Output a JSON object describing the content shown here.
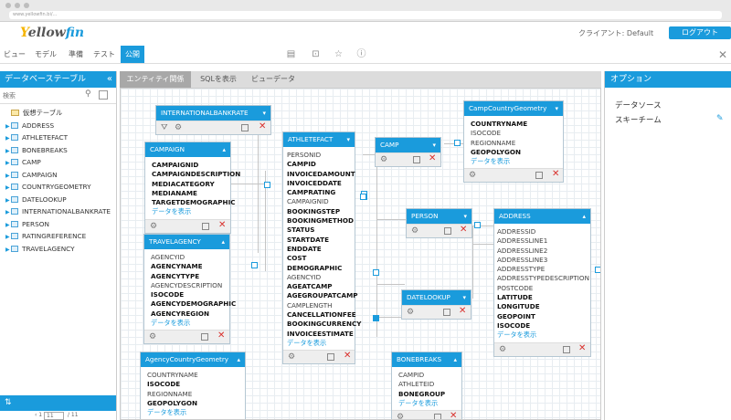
{
  "browser": {
    "url": "www.yellowfin.bi/..."
  },
  "header": {
    "logo": {
      "y": "Y",
      "ellow": "ellow",
      "fin": "fin"
    },
    "client_label": "クライアント: Default",
    "logout_label": "ログアウト"
  },
  "menubar": {
    "items": [
      "ビュー",
      "モデル",
      "準備",
      "テスト",
      "公開"
    ],
    "active_index": 4,
    "tool_icons": [
      "table-icon",
      "lock-icon",
      "star-icon",
      "info-icon"
    ]
  },
  "left_panel": {
    "title": "データベーステーブル",
    "collapse_glyph": "«",
    "search_placeholder": "検索",
    "items": [
      {
        "label": "仮想テーブル",
        "type": "folder"
      },
      {
        "label": "ADDRESS",
        "type": "table"
      },
      {
        "label": "ATHLETEFACT",
        "type": "table"
      },
      {
        "label": "BONEBREAKS",
        "type": "table"
      },
      {
        "label": "CAMP",
        "type": "table"
      },
      {
        "label": "CAMPAIGN",
        "type": "table"
      },
      {
        "label": "COUNTRYGEOMETRY",
        "type": "table"
      },
      {
        "label": "DATELOOKUP",
        "type": "table"
      },
      {
        "label": "INTERNATIONALBANKRATE",
        "type": "table"
      },
      {
        "label": "PERSON",
        "type": "table"
      },
      {
        "label": "RATINGREFERENCE",
        "type": "table"
      },
      {
        "label": "TRAVELAGENCY",
        "type": "table"
      }
    ],
    "pager": {
      "prev": "‹ 1",
      "current": "11",
      "total": "/ 11"
    }
  },
  "tabs": [
    "エンティティ関係",
    "SQLを表示",
    "ビューデータ"
  ],
  "active_tab": 0,
  "entities": {
    "internationalbankrate": {
      "name": "INTERNATIONALBANKRATE",
      "fields": []
    },
    "campaign": {
      "name": "CAMPAIGN",
      "fields": [
        {
          "label": "CAMPAIGNID",
          "bold": true
        },
        {
          "label": "CAMPAIGNDESCRIPTION",
          "bold": true
        },
        {
          "label": "MEDIACATEGORY",
          "bold": true
        },
        {
          "label": "MEDIANAME",
          "bold": true
        },
        {
          "label": "TARGETDEMOGRAPHIC",
          "bold": true
        }
      ],
      "more": "データを表示"
    },
    "travelagency": {
      "name": "TRAVELAGENCY",
      "fields": [
        {
          "label": "AGENCYID",
          "bold": false
        },
        {
          "label": "AGENCYNAME",
          "bold": true
        },
        {
          "label": "AGENCYTYPE",
          "bold": true
        },
        {
          "label": "AGENCYDESCRIPTION",
          "bold": false
        },
        {
          "label": "ISOCODE",
          "bold": true
        },
        {
          "label": "AGENCYDEMOGRAPHIC",
          "bold": true
        },
        {
          "label": "AGENCYREGION",
          "bold": true
        }
      ],
      "more": "データを表示"
    },
    "agencycountrygeometry": {
      "name": "AgencyCountryGeometry",
      "fields": [
        {
          "label": "COUNTRYNAME",
          "bold": false
        },
        {
          "label": "ISOCODE",
          "bold": true
        },
        {
          "label": "REGIONNAME",
          "bold": false
        },
        {
          "label": "GEOPOLYGON",
          "bold": true
        }
      ],
      "more": "データを表示"
    },
    "athletefact": {
      "name": "ATHLETEFACT",
      "fields": [
        {
          "label": "PERSONID",
          "bold": false
        },
        {
          "label": "CAMPID",
          "bold": true
        },
        {
          "label": "INVOICEDAMOUNT",
          "bold": true
        },
        {
          "label": "INVOICEDDATE",
          "bold": true
        },
        {
          "label": "CAMPRATING",
          "bold": true
        },
        {
          "label": "CAMPAIGNID",
          "bold": false
        },
        {
          "label": "BOOKINGSTEP",
          "bold": true
        },
        {
          "label": "BOOKINGMETHOD",
          "bold": true
        },
        {
          "label": "STATUS",
          "bold": true
        },
        {
          "label": "STARTDATE",
          "bold": true
        },
        {
          "label": "ENDDATE",
          "bold": true
        },
        {
          "label": "COST",
          "bold": true
        },
        {
          "label": "DEMOGRAPHIC",
          "bold": true
        },
        {
          "label": "AGENCYID",
          "bold": false
        },
        {
          "label": "AGEATCAMP",
          "bold": true
        },
        {
          "label": "AGEGROUPATCAMP",
          "bold": true
        },
        {
          "label": "CAMPLENGTH",
          "bold": false
        },
        {
          "label": "CANCELLATIONFEE",
          "bold": true
        },
        {
          "label": "BOOKINGCURRENCY",
          "bold": true
        },
        {
          "label": "INVOICEESTIMATE",
          "bold": true
        }
      ],
      "more": "データを表示"
    },
    "camp": {
      "name": "CAMP",
      "fields": []
    },
    "campcountrygeometry": {
      "name": "CampCountryGeometry",
      "fields": [
        {
          "label": "COUNTRYNAME",
          "bold": true
        },
        {
          "label": "ISOCODE",
          "bold": false
        },
        {
          "label": "REGIONNAME",
          "bold": false
        },
        {
          "label": "GEOPOLYGON",
          "bold": true
        }
      ],
      "more": "データを表示"
    },
    "person": {
      "name": "PERSON",
      "fields": []
    },
    "address": {
      "name": "ADDRESS",
      "fields": [
        {
          "label": "ADDRESSID",
          "bold": false
        },
        {
          "label": "ADDRESSLINE1",
          "bold": false
        },
        {
          "label": "ADDRESSLINE2",
          "bold": false
        },
        {
          "label": "ADDRESSLINE3",
          "bold": false
        },
        {
          "label": "ADDRESSTYPE",
          "bold": false
        },
        {
          "label": "ADDRESSTYPEDESCRIPTION",
          "bold": false
        },
        {
          "label": "POSTCODE",
          "bold": false
        },
        {
          "label": "LATITUDE",
          "bold": true
        },
        {
          "label": "LONGITUDE",
          "bold": true
        },
        {
          "label": "GEOPOINT",
          "bold": true
        },
        {
          "label": "ISOCODE",
          "bold": true
        }
      ],
      "more": "データを表示"
    },
    "datelookup": {
      "name": "DATELOOKUP",
      "fields": []
    },
    "bonebreaks": {
      "name": "BONEBREAKS",
      "fields": [
        {
          "label": "CAMPID",
          "bold": false
        },
        {
          "label": "ATHLETEID",
          "bold": false
        },
        {
          "label": "BONEGROUP",
          "bold": true
        }
      ],
      "more": "データを表示"
    }
  },
  "right_panel": {
    "title": "オプション",
    "items": [
      "データソース",
      "スキーチーム"
    ]
  }
}
